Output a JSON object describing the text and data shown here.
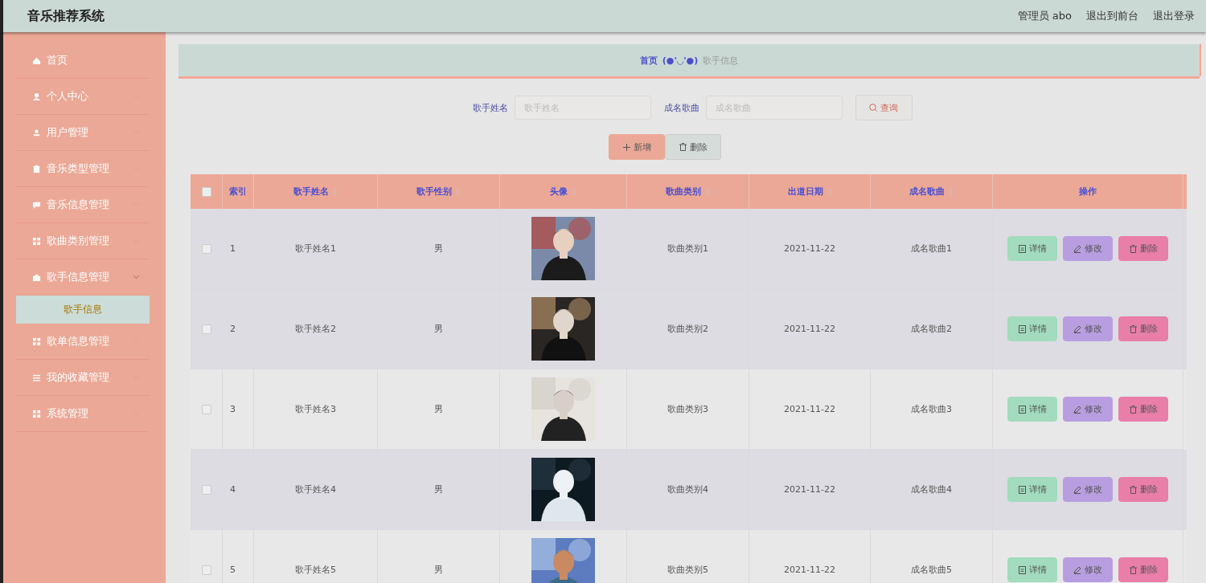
{
  "header": {
    "title": "音乐推荐系统",
    "links": [
      "管理员 abo",
      "退出到前台",
      "退出登录"
    ]
  },
  "sidebar": {
    "items": [
      {
        "label": "首页",
        "kind": "link"
      },
      {
        "label": "个人中心",
        "kind": "menu",
        "expanded": false
      },
      {
        "label": "用户管理",
        "kind": "menu",
        "expanded": false
      },
      {
        "label": "音乐类型管理",
        "kind": "menu",
        "expanded": false
      },
      {
        "label": "音乐信息管理",
        "kind": "menu",
        "expanded": false
      },
      {
        "label": "歌曲类别管理",
        "kind": "menu",
        "expanded": false
      },
      {
        "label": "歌手信息管理",
        "kind": "menu",
        "expanded": true,
        "children": [
          {
            "label": "歌手信息",
            "selected": true
          }
        ]
      },
      {
        "label": "歌单信息管理",
        "kind": "menu",
        "expanded": false
      },
      {
        "label": "我的收藏管理",
        "kind": "menu",
        "expanded": false
      },
      {
        "label": "系统管理",
        "kind": "menu",
        "expanded": false
      }
    ]
  },
  "breadcrumb": {
    "home": "首页",
    "separator": "(●'◡'●)",
    "current": "歌手信息"
  },
  "search": {
    "fields": [
      {
        "label": "歌手姓名",
        "placeholder": "歌手姓名"
      },
      {
        "label": "成名歌曲",
        "placeholder": "成名歌曲"
      }
    ],
    "button": "查询"
  },
  "actions": {
    "add": "新增",
    "delete": "删除"
  },
  "table": {
    "select_all_checked": false,
    "columns": [
      {
        "label": "索引",
        "sortable": false
      },
      {
        "label": "歌手姓名",
        "sortable": true
      },
      {
        "label": "歌手性别",
        "sortable": true
      },
      {
        "label": "头像",
        "sortable": true
      },
      {
        "label": "歌曲类别",
        "sortable": true
      },
      {
        "label": "出道日期",
        "sortable": true
      },
      {
        "label": "成名歌曲",
        "sortable": true
      },
      {
        "label": "操作",
        "sortable": false
      }
    ],
    "rows": [
      {
        "index": "1",
        "name": "歌手姓名1",
        "gender": "男",
        "category": "歌曲类别1",
        "date": "2021-11-22",
        "song": "成名歌曲1",
        "checked": false,
        "shaded": true,
        "buttons": [
          "详情",
          "修改",
          "删除"
        ]
      },
      {
        "index": "2",
        "name": "歌手姓名2",
        "gender": "男",
        "category": "歌曲类别2",
        "date": "2021-11-22",
        "song": "成名歌曲2",
        "checked": false,
        "shaded": true,
        "buttons": [
          "详情",
          "修改",
          "删除"
        ]
      },
      {
        "index": "3",
        "name": "歌手姓名3",
        "gender": "男",
        "category": "歌曲类别3",
        "date": "2021-11-22",
        "song": "成名歌曲3",
        "checked": false,
        "shaded": false,
        "buttons": [
          "详情",
          "修改",
          "删除"
        ]
      },
      {
        "index": "4",
        "name": "歌手姓名4",
        "gender": "男",
        "category": "歌曲类别4",
        "date": "2021-11-22",
        "song": "成名歌曲4",
        "checked": false,
        "shaded": true,
        "buttons": [
          "详情",
          "修改",
          "删除"
        ]
      },
      {
        "index": "5",
        "name": "歌手姓名5",
        "gender": "男",
        "category": "歌曲类别5",
        "date": "2021-11-22",
        "song": "成名歌曲5",
        "checked": false,
        "shaded": false,
        "buttons": [
          "详情",
          "修改",
          "删除"
        ]
      }
    ]
  }
}
